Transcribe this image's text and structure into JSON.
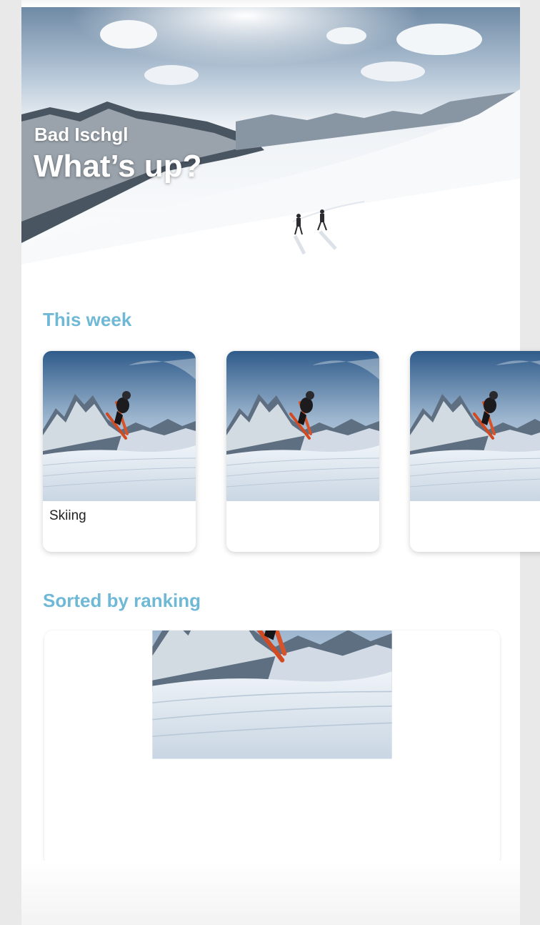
{
  "hero": {
    "subtitle": "Bad Ischgl",
    "title": "What’s up?"
  },
  "sections": {
    "this_week": "This week",
    "sorted_by_ranking": "Sorted by ranking"
  },
  "cards": [
    {
      "label": "Skiing",
      "image": "skier-jump-photo"
    },
    {
      "label": "",
      "image": "skier-jump-photo"
    },
    {
      "label": "",
      "image": "skier-jump-photo"
    }
  ],
  "ranking": {
    "image": "skier-jump-photo"
  },
  "colors": {
    "accent": "#6fb8d6",
    "card_text": "#222222",
    "background": "#ffffff"
  }
}
